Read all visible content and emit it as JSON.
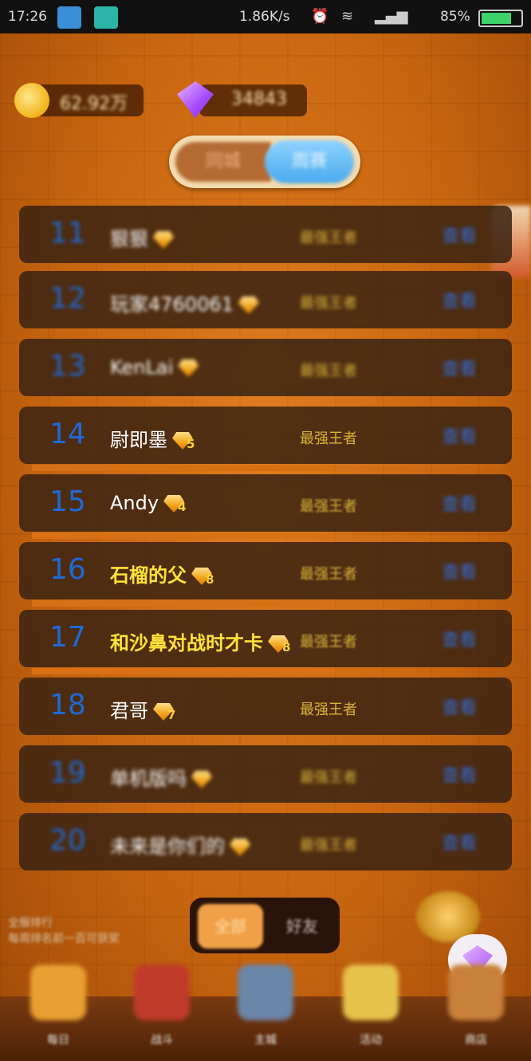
{
  "status_bar": {
    "time": "17:26",
    "speed": "1.86K/s",
    "battery_pct": "85%",
    "battery_level": 0.85,
    "icons": [
      "alarm-icon",
      "wifi-icon",
      "signal-icon"
    ]
  },
  "currency": {
    "coins": "62.92",
    "coin_unit": "万",
    "gems": "34843"
  },
  "scope_toggle": {
    "left_label": "同城",
    "right_label": "周赛"
  },
  "rows": [
    {
      "rank": "11",
      "name": "狠狠",
      "badge": "",
      "label": "最强王者",
      "action": "查看"
    },
    {
      "rank": "12",
      "name": "玩家4760061",
      "badge": "",
      "label": "最强王者",
      "action": "查看"
    },
    {
      "rank": "13",
      "name": "KenLai",
      "badge": "",
      "label": "最强王者",
      "action": "查看"
    },
    {
      "rank": "14",
      "name": "尉即墨",
      "badge": "5",
      "label": "最强王者",
      "action": "查看"
    },
    {
      "rank": "15",
      "name": "Andy",
      "badge": "4",
      "label": "最强王者",
      "action": "查看"
    },
    {
      "rank": "16",
      "name": "石榴的父",
      "badge": "8",
      "label": "最强王者",
      "action": "查看"
    },
    {
      "rank": "17",
      "name": "和沙鼻对战时才卡",
      "badge": "8",
      "label": "最强王者",
      "action": "查看"
    },
    {
      "rank": "18",
      "name": "君哥",
      "badge": "7",
      "label": "最强王者",
      "action": "查看"
    },
    {
      "rank": "19",
      "name": "单机版吗",
      "badge": "",
      "label": "最强王者",
      "action": "查看"
    },
    {
      "rank": "20",
      "name": "未来是你们的",
      "badge": "",
      "label": "最强王者",
      "action": "查看"
    }
  ],
  "bottom": {
    "info_line1": "全服排行",
    "info_line2": "每周排名前一百可获奖",
    "seg_left": "全部",
    "seg_right": "好友"
  },
  "nav": [
    {
      "label": "每日",
      "icon": "chest-icon"
    },
    {
      "label": "战斗",
      "icon": "sword-icon"
    },
    {
      "label": "主城",
      "icon": "castle-icon"
    },
    {
      "label": "活动",
      "icon": "food-icon"
    },
    {
      "label": "商店",
      "icon": "shop-icon"
    }
  ]
}
